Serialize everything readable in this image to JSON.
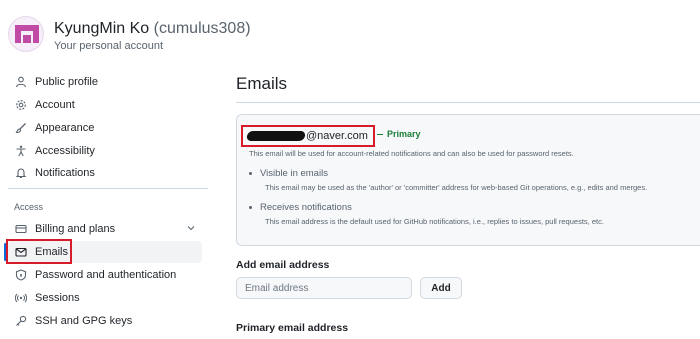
{
  "header": {
    "display_name": "KyungMin Ko",
    "login": "(cumulus308)",
    "subtitle": "Your personal account"
  },
  "sidebar": {
    "items": [
      {
        "label": "Public profile",
        "icon": "person-icon"
      },
      {
        "label": "Account",
        "icon": "gear-icon"
      },
      {
        "label": "Appearance",
        "icon": "paintbrush-icon"
      },
      {
        "label": "Accessibility",
        "icon": "accessibility-icon"
      },
      {
        "label": "Notifications",
        "icon": "bell-icon"
      }
    ],
    "access_label": "Access",
    "access_items": [
      {
        "label": "Billing and plans",
        "icon": "credit-card-icon"
      },
      {
        "label": "Emails",
        "icon": "mail-icon",
        "active": true
      },
      {
        "label": "Password and authentication",
        "icon": "shield-lock-icon"
      },
      {
        "label": "Sessions",
        "icon": "broadcast-icon"
      },
      {
        "label": "SSH and GPG keys",
        "icon": "key-icon"
      }
    ]
  },
  "main": {
    "title": "Emails",
    "email": {
      "domain": "@naver.com",
      "primary_label": "Primary",
      "note": "This email will be used for account-related notifications and can also be used for password resets.",
      "bullets": [
        {
          "title": "Visible in emails",
          "desc": "This email may be used as the 'author' or 'committer' address for web-based Git operations, e.g., edits and merges."
        },
        {
          "title": "Receives notifications",
          "desc": "This email address is the default used for GitHub notifications, i.e., replies to issues, pull requests, etc."
        }
      ]
    },
    "add_email": {
      "label": "Add email address",
      "placeholder": "Email address",
      "button": "Add"
    },
    "primary_email_label": "Primary email address"
  },
  "colors": {
    "accent": "#0969da",
    "primary_green": "#1a7f37",
    "highlight_red": "#d81b2b",
    "avatar_pink": "#b0459a"
  }
}
